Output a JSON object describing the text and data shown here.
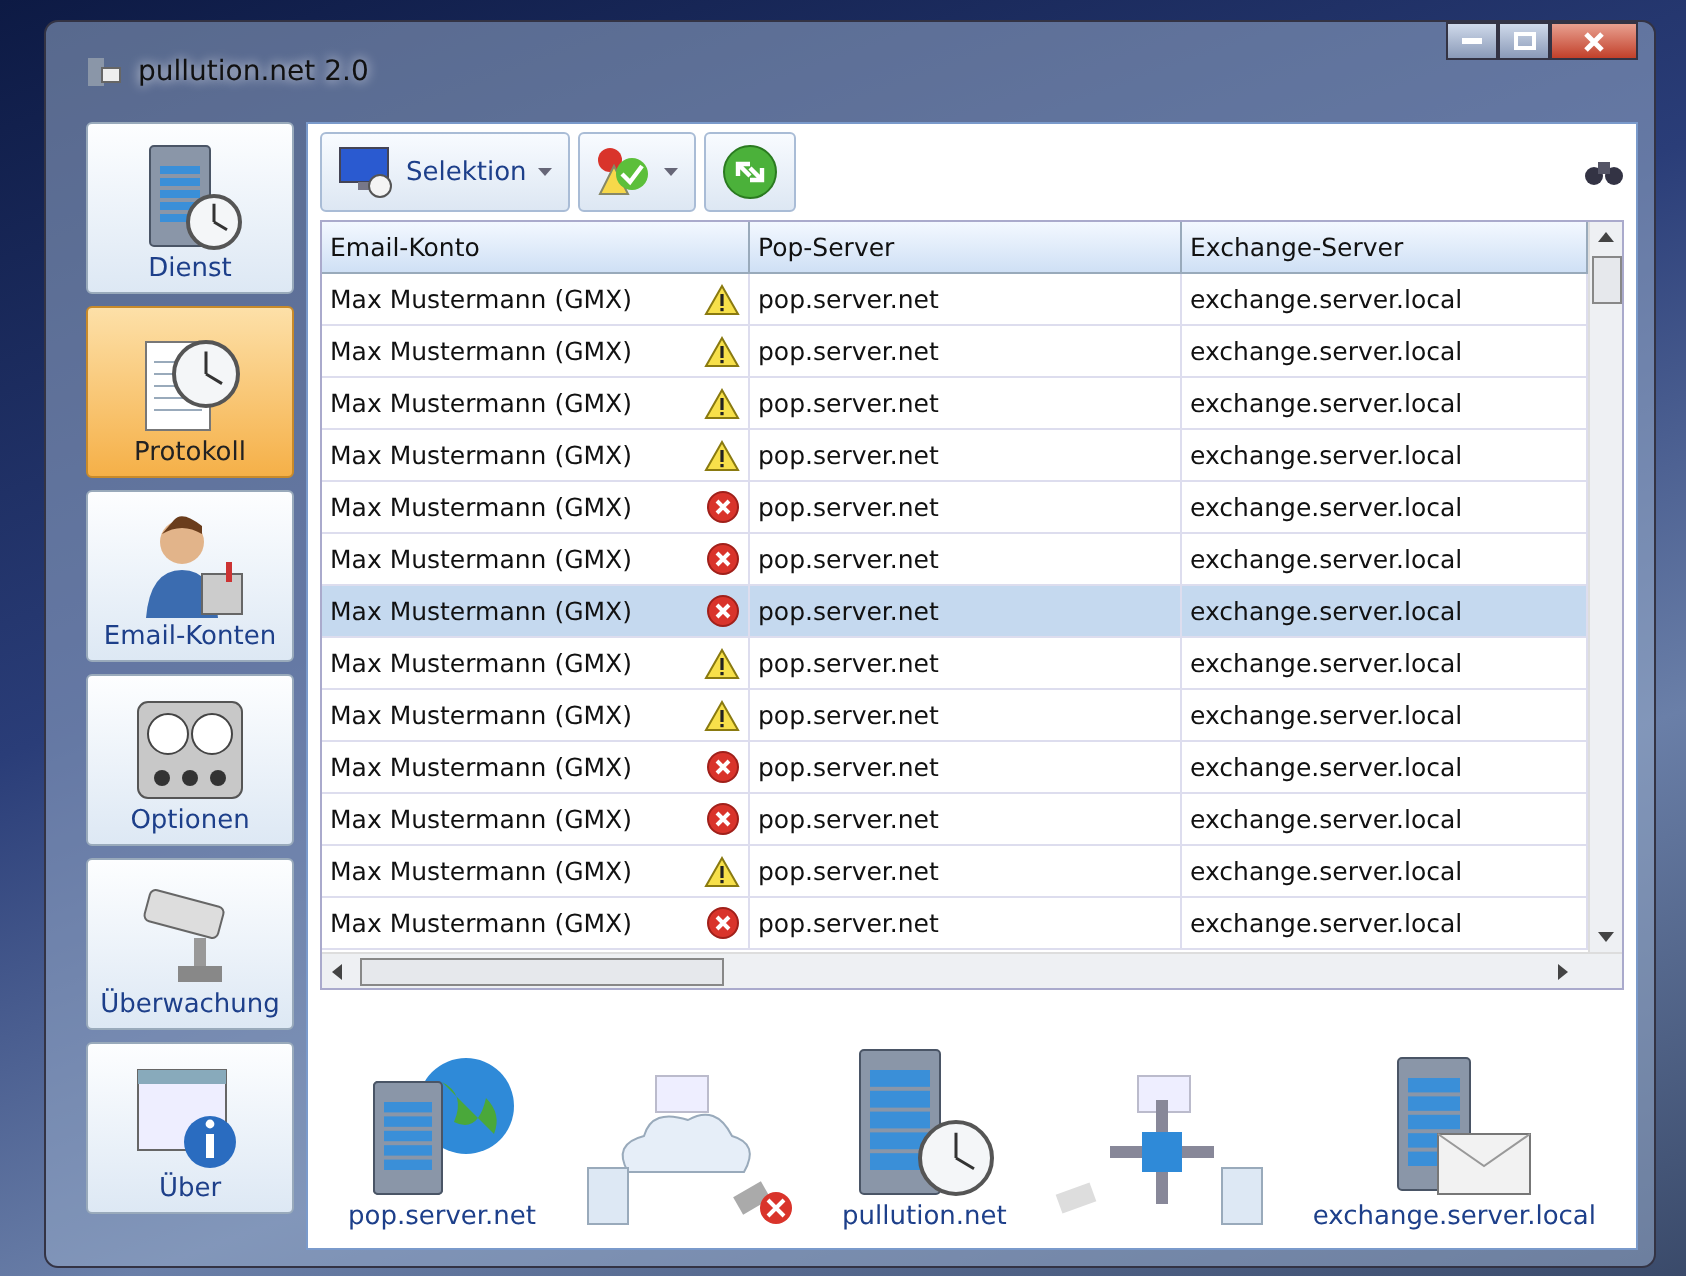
{
  "window": {
    "title": "pullution.net 2.0"
  },
  "sidebar": {
    "items": [
      {
        "label": "Dienst",
        "kind": "server",
        "selected": false
      },
      {
        "label": "Protokoll",
        "kind": "log",
        "selected": true
      },
      {
        "label": "Email-Konten",
        "kind": "user",
        "selected": false
      },
      {
        "label": "Optionen",
        "kind": "gauges",
        "selected": false
      },
      {
        "label": "Überwachung",
        "kind": "camera",
        "selected": false
      },
      {
        "label": "Über",
        "kind": "info",
        "selected": false
      }
    ]
  },
  "toolbar": {
    "buttons": [
      {
        "label": "Selektion",
        "kind": "monitor"
      },
      {
        "kind": "status"
      },
      {
        "kind": "refresh"
      }
    ]
  },
  "table": {
    "columns": [
      "Email-Konto",
      "Pop-Server",
      "Exchange-Server"
    ],
    "rows": [
      {
        "account": "Max Mustermann (GMX)",
        "kind": "warning",
        "pop": "pop.server.net",
        "exchange": "exchange.server.local",
        "selected": false
      },
      {
        "account": "Max Mustermann (GMX)",
        "kind": "warning",
        "pop": "pop.server.net",
        "exchange": "exchange.server.local",
        "selected": false
      },
      {
        "account": "Max Mustermann (GMX)",
        "kind": "warning",
        "pop": "pop.server.net",
        "exchange": "exchange.server.local",
        "selected": false
      },
      {
        "account": "Max Mustermann (GMX)",
        "kind": "warning",
        "pop": "pop.server.net",
        "exchange": "exchange.server.local",
        "selected": false
      },
      {
        "account": "Max Mustermann (GMX)",
        "kind": "error",
        "pop": "pop.server.net",
        "exchange": "exchange.server.local",
        "selected": false
      },
      {
        "account": "Max Mustermann (GMX)",
        "kind": "error",
        "pop": "pop.server.net",
        "exchange": "exchange.server.local",
        "selected": false
      },
      {
        "account": "Max Mustermann (GMX)",
        "kind": "error",
        "pop": "pop.server.net",
        "exchange": "exchange.server.local",
        "selected": true
      },
      {
        "account": "Max Mustermann (GMX)",
        "kind": "warning",
        "pop": "pop.server.net",
        "exchange": "exchange.server.local",
        "selected": false
      },
      {
        "account": "Max Mustermann (GMX)",
        "kind": "warning",
        "pop": "pop.server.net",
        "exchange": "exchange.server.local",
        "selected": false
      },
      {
        "account": "Max Mustermann (GMX)",
        "kind": "error",
        "pop": "pop.server.net",
        "exchange": "exchange.server.local",
        "selected": false
      },
      {
        "account": "Max Mustermann (GMX)",
        "kind": "error",
        "pop": "pop.server.net",
        "exchange": "exchange.server.local",
        "selected": false
      },
      {
        "account": "Max Mustermann (GMX)",
        "kind": "warning",
        "pop": "pop.server.net",
        "exchange": "exchange.server.local",
        "selected": false
      },
      {
        "account": "Max Mustermann (GMX)",
        "kind": "error",
        "pop": "pop.server.net",
        "exchange": "exchange.server.local",
        "selected": false
      }
    ]
  },
  "diagram": {
    "pop_server": "pop.server.net",
    "service": "pullution.net",
    "exchange_server": "exchange.server.local",
    "pop_link_error": true
  }
}
